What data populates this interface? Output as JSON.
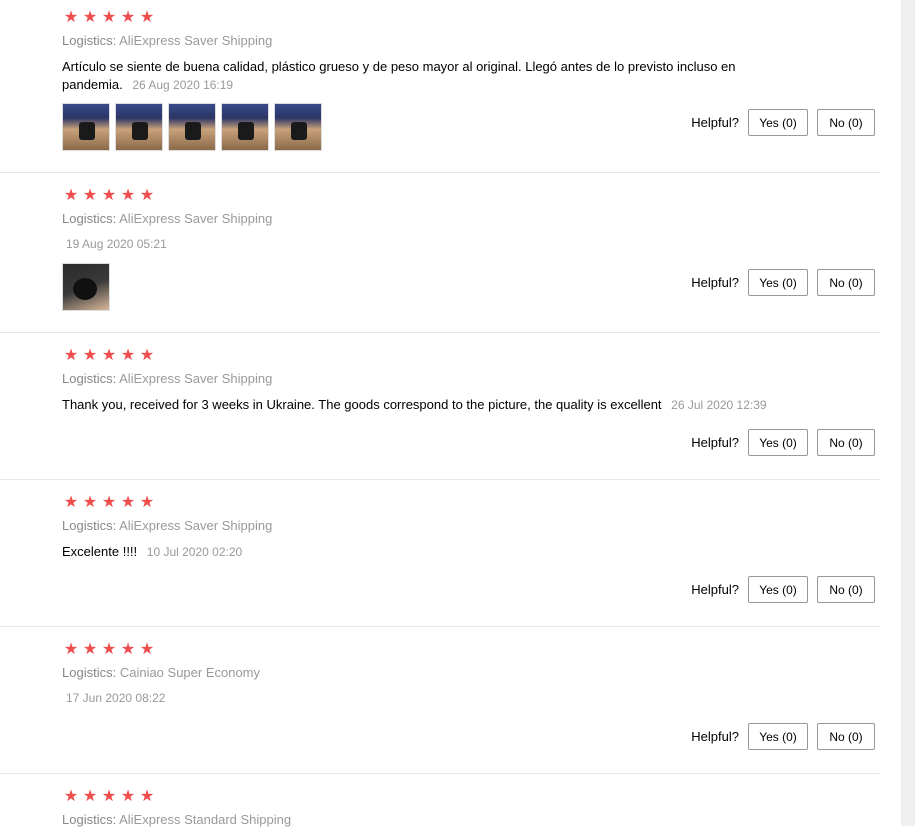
{
  "labels": {
    "logistics": "Logistics:",
    "helpful": "Helpful?",
    "yes": "Yes (0)",
    "no": "No (0)",
    "star": "★"
  },
  "reviews": [
    {
      "rating": 5,
      "logistics": "AliExpress Saver Shipping",
      "text": "Artículo se siente de buena calidad, plástico grueso y de peso mayor al original. Llegó antes de lo previsto incluso en pandemia.",
      "date": "26 Aug 2020 16:19",
      "photos": 5
    },
    {
      "rating": 5,
      "logistics": "AliExpress Saver Shipping",
      "text": "",
      "date": "19 Aug 2020 05:21",
      "photos": 1
    },
    {
      "rating": 5,
      "logistics": "AliExpress Saver Shipping",
      "text": "Thank you, received for 3 weeks in Ukraine. The goods correspond to the picture, the quality is excellent",
      "date": "26 Jul 2020 12:39",
      "photos": 0
    },
    {
      "rating": 5,
      "logistics": "AliExpress Saver Shipping",
      "text": "Excelente !!!!",
      "date": "10 Jul 2020 02:20",
      "photos": 0
    },
    {
      "rating": 5,
      "logistics": "Cainiao Super Economy",
      "text": "",
      "date": "17 Jun 2020 08:22",
      "photos": 0
    },
    {
      "rating": 5,
      "logistics": "AliExpress Standard Shipping",
      "text": "",
      "date": "",
      "photos": 0
    }
  ]
}
